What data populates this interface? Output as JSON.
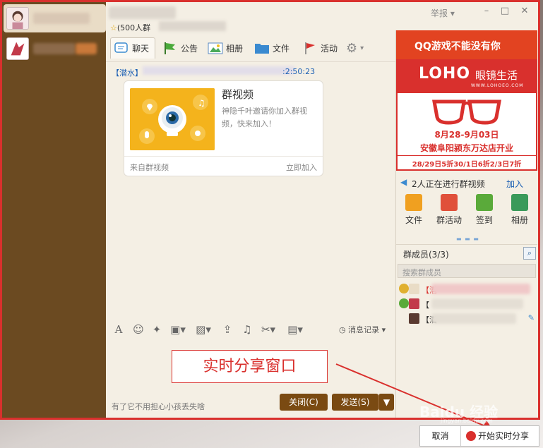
{
  "window": {
    "group_subtitle": "(500人群",
    "report": "举报",
    "minimize": "–",
    "maximize": "□",
    "close": "✕"
  },
  "tabs": [
    {
      "label": "聊天",
      "icon": "chat-bubble-icon"
    },
    {
      "label": "公告",
      "icon": "flag-icon"
    },
    {
      "label": "相册",
      "icon": "photo-icon"
    },
    {
      "label": "文件",
      "icon": "folder-icon"
    },
    {
      "label": "活动",
      "icon": "pennant-icon"
    }
  ],
  "chat": {
    "sender_tag": "【潜水】",
    "time": ":2:50:23",
    "card": {
      "title": "群视频",
      "description": "神隐千叶邀请你加入群视频，快来加入！",
      "source": "来自群视频",
      "join": "立即加入"
    }
  },
  "input_toolbar": {
    "history": "消息记录"
  },
  "input": {
    "share_window_label": "实时分享窗口",
    "tip": "有了它不用担心小孩丢失啥",
    "close_button": "关闭(C)",
    "send_button": "发送(S)",
    "send_arrow": "▼"
  },
  "right_panel": {
    "ad_game": "QQ游戏不能没有你",
    "loho": {
      "logo": "LOHO",
      "name": "眼镜生活",
      "url": "WWW.LOHOEO.COM",
      "date": "8月28-9月03日",
      "store": "安徽阜阳颍东万达店开业",
      "discount": "28/29日5折30/1日6折2/3日7折"
    },
    "video_status": "2人正在进行群视频",
    "video_join": "加入",
    "apps": [
      {
        "label": "文件",
        "color": "#f0a020"
      },
      {
        "label": "群活动",
        "color": "#e0503a"
      },
      {
        "label": "签到",
        "color": "#5aaa3a"
      },
      {
        "label": "相册",
        "color": "#3a9a5a"
      }
    ],
    "members_title": "群成员(3/3)",
    "member_search_placeholder": "搜索群成员",
    "members": [
      {
        "prefix": "【潜",
        "color": "#d9302d"
      },
      {
        "prefix": "【",
        "color": "#333333"
      },
      {
        "prefix": "【潜",
        "color": "#333333"
      }
    ]
  },
  "share_controls": {
    "cancel": "取消",
    "start": "开始实时分享"
  },
  "watermark": {
    "text": "Baidu 经验",
    "url": "jingyan.baidu.com"
  }
}
